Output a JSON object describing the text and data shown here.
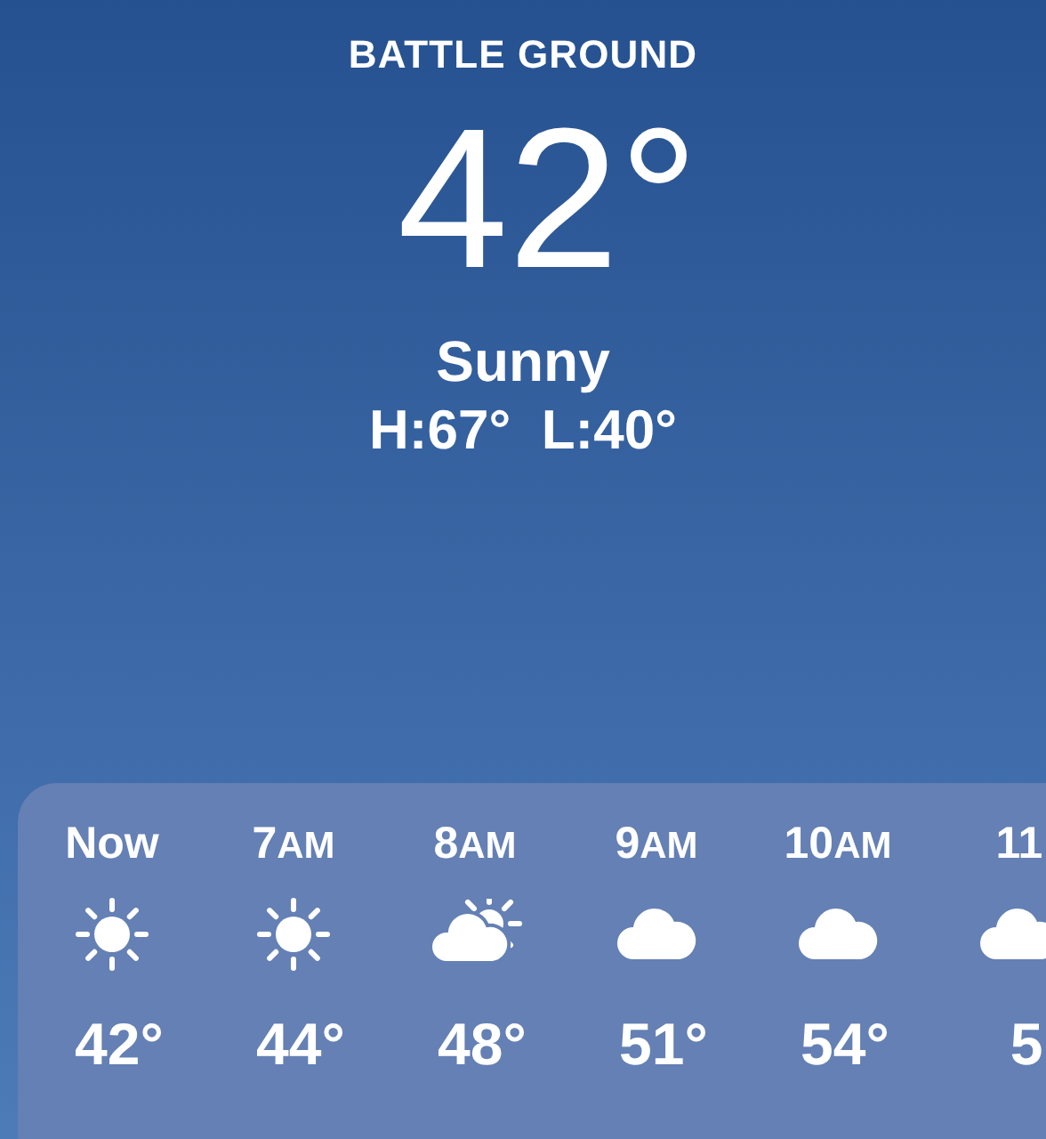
{
  "location": "BATTLE GROUND",
  "temperature": "42°",
  "condition": "Sunny",
  "high_low": "H:67°  L:40°",
  "hourly": [
    {
      "hour": "Now",
      "kind": "sun",
      "temp": "42°"
    },
    {
      "hour": "7",
      "period": "AM",
      "kind": "sun",
      "temp": "44°"
    },
    {
      "hour": "8",
      "period": "AM",
      "kind": "partly-cloudy",
      "temp": "48°"
    },
    {
      "hour": "9",
      "period": "AM",
      "kind": "cloud",
      "temp": "51°"
    },
    {
      "hour": "10",
      "period": "AM",
      "kind": "cloud",
      "temp": "54°"
    },
    {
      "hour": "11",
      "kind": "cloud",
      "temp": "5"
    }
  ]
}
